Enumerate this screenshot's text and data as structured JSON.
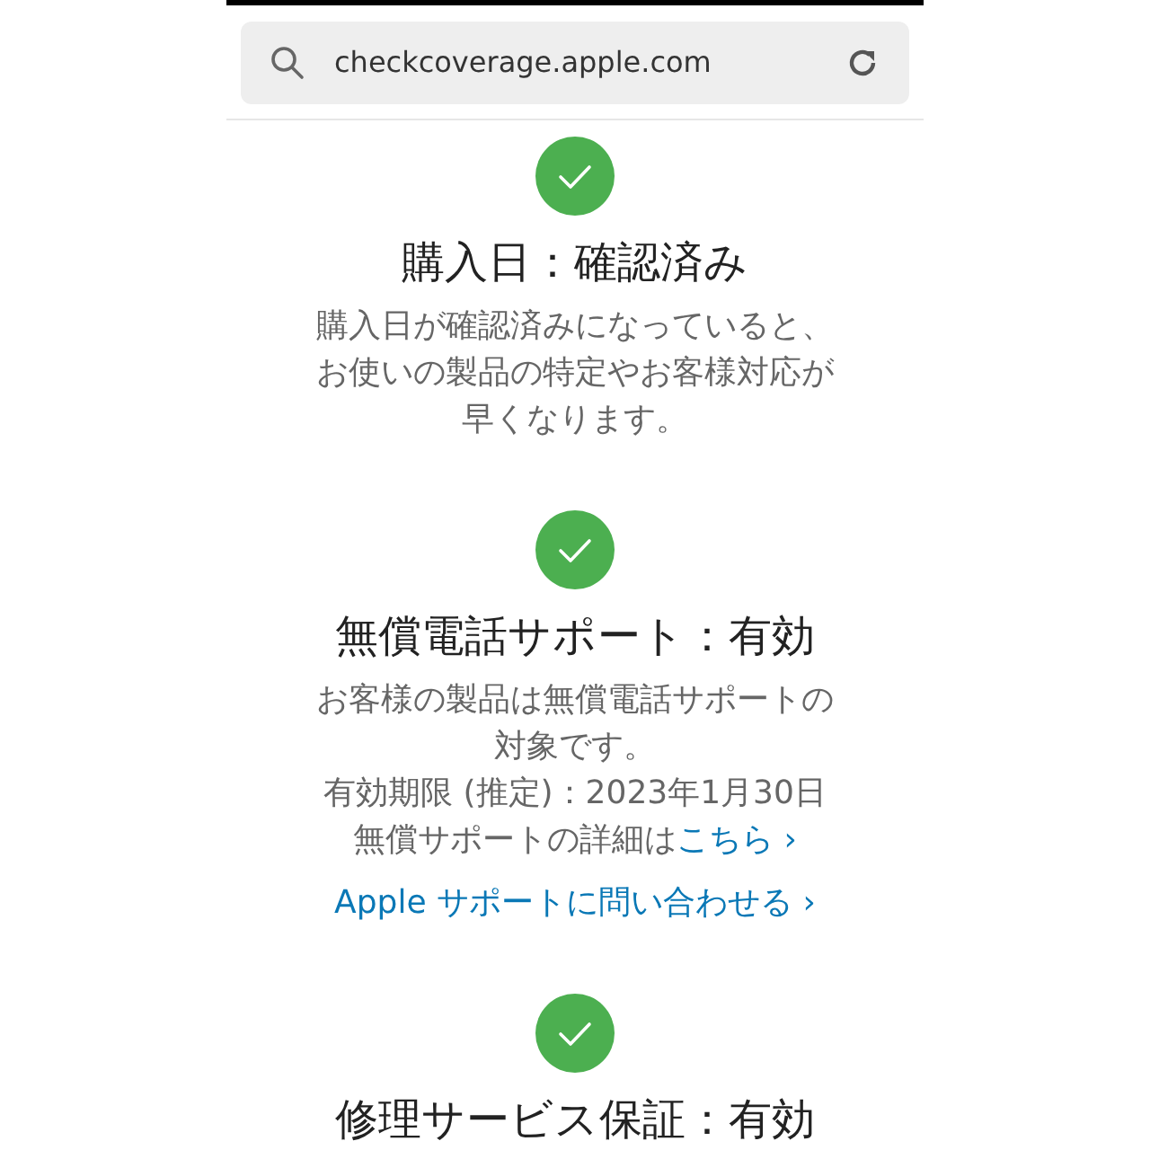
{
  "address_bar": {
    "url": "checkcoverage.apple.com"
  },
  "sections": [
    {
      "verified": true,
      "title": "購入日：確認済み",
      "lines": [
        {
          "text": "購入日が確認済みになっていると、"
        },
        {
          "text": "お使いの製品の特定やお客様対応が"
        },
        {
          "text": "早くなります。"
        }
      ]
    },
    {
      "verified": true,
      "title": "無償電話サポート：有効",
      "lines": [
        {
          "text": "お客様の製品は無償電話サポートの"
        },
        {
          "text": "対象です。"
        },
        {
          "text": "有効期限 (推定)：2023年1月30日"
        },
        {
          "text": "無償サポートの詳細は",
          "link": "こちら ›"
        }
      ],
      "contact_link": "Apple サポートに問い合わせる ›"
    },
    {
      "verified": true,
      "title": "修理サービス保証：有効"
    }
  ]
}
